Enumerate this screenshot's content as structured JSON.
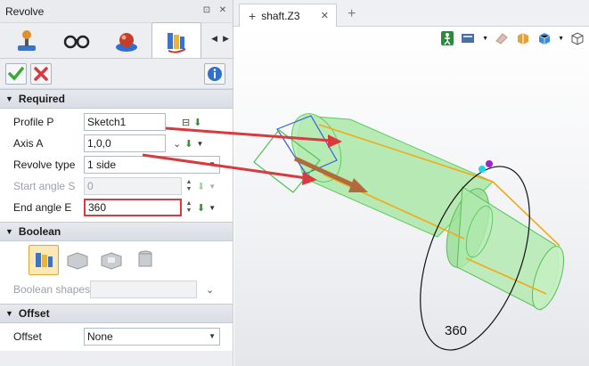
{
  "panel": {
    "title": "Revolve",
    "tabs": [
      {
        "name": "feature-tab",
        "icon": "joystick-icon"
      },
      {
        "name": "view-tab",
        "icon": "glasses-icon"
      },
      {
        "name": "render-tab",
        "icon": "sphere-icon"
      },
      {
        "name": "revolve-tab",
        "icon": "revolve-icon",
        "active": true
      }
    ],
    "actions": {
      "ok_icon": "checkmark-icon",
      "cancel_icon": "x-icon",
      "info_icon": "info-icon"
    },
    "required": {
      "header": "Required",
      "profile_label": "Profile P",
      "profile_value": "Sketch1",
      "axis_label": "Axis A",
      "axis_value": "1,0,0",
      "revolve_type_label": "Revolve type",
      "revolve_type_value": "1 side",
      "start_angle_label": "Start angle S",
      "start_angle_value": "0",
      "end_angle_label": "End angle E",
      "end_angle_value": "360"
    },
    "boolean": {
      "header": "Boolean",
      "shapes_label": "Boolean shapes",
      "shapes_value": ""
    },
    "offset": {
      "header": "Offset",
      "offset_label": "Offset",
      "offset_value": "None"
    }
  },
  "document": {
    "tab_label": "shaft.Z3",
    "new_tab": "+"
  },
  "viewport": {
    "dimension_label": "360"
  },
  "colors": {
    "accent_red": "#d9393f",
    "part_green": "#8fe08f",
    "edge_orange": "#f3a916"
  }
}
